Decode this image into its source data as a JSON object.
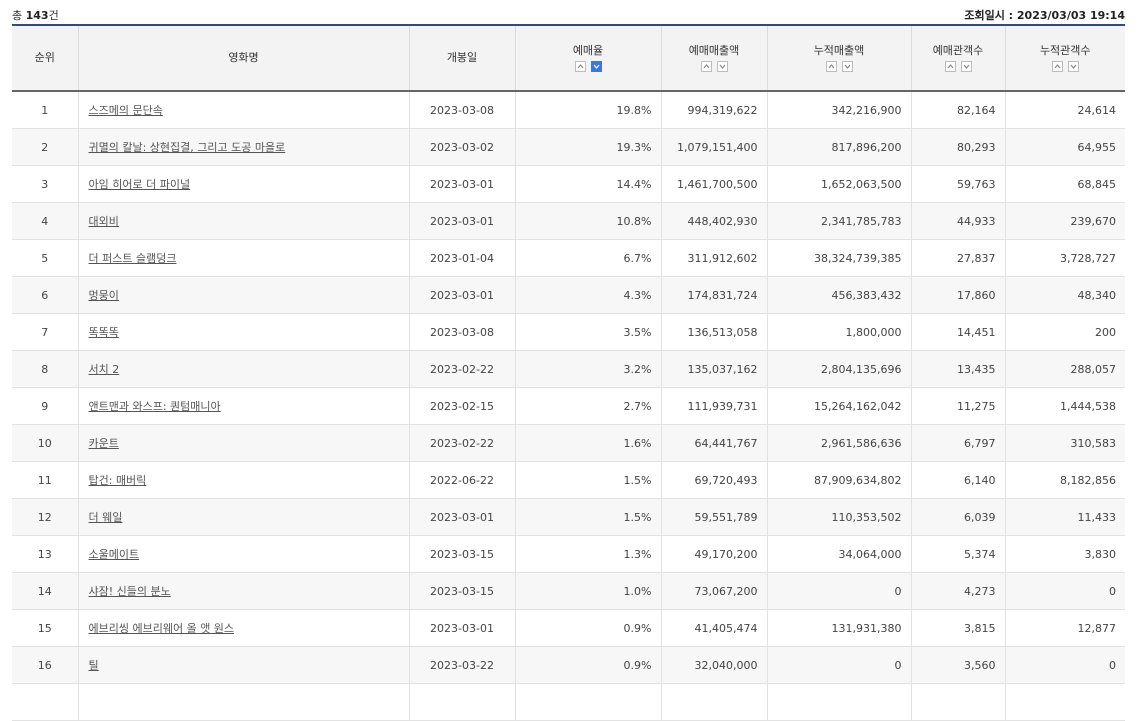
{
  "header": {
    "total_prefix": "총",
    "total_count": "143",
    "total_suffix": "건",
    "timestamp": "조회일시 : 2023/03/03 19:14"
  },
  "columns": [
    {
      "key": "rank",
      "label": "순위",
      "sortable": false
    },
    {
      "key": "title",
      "label": "영화명",
      "sortable": false
    },
    {
      "key": "release",
      "label": "개봉일",
      "sortable": false
    },
    {
      "key": "rate",
      "label": "예매율",
      "sortable": true,
      "active": "down"
    },
    {
      "key": "sales",
      "label": "예매매출액",
      "sortable": true
    },
    {
      "key": "cum_sales",
      "label": "누적매출액",
      "sortable": true
    },
    {
      "key": "audience",
      "label": "예매관객수",
      "sortable": true
    },
    {
      "key": "cum_audience",
      "label": "누적관객수",
      "sortable": true
    }
  ],
  "rows": [
    {
      "rank": "1",
      "title": "스즈메의 문단속",
      "release": "2023-03-08",
      "rate": "19.8%",
      "sales": "994,319,622",
      "cum_sales": "342,216,900",
      "audience": "82,164",
      "cum_audience": "24,614"
    },
    {
      "rank": "2",
      "title": "귀멸의 칼날: 상현집결, 그리고 도공 마을로",
      "release": "2023-03-02",
      "rate": "19.3%",
      "sales": "1,079,151,400",
      "cum_sales": "817,896,200",
      "audience": "80,293",
      "cum_audience": "64,955"
    },
    {
      "rank": "3",
      "title": "아임 히어로 더 파이널",
      "release": "2023-03-01",
      "rate": "14.4%",
      "sales": "1,461,700,500",
      "cum_sales": "1,652,063,500",
      "audience": "59,763",
      "cum_audience": "68,845"
    },
    {
      "rank": "4",
      "title": "대외비",
      "release": "2023-03-01",
      "rate": "10.8%",
      "sales": "448,402,930",
      "cum_sales": "2,341,785,783",
      "audience": "44,933",
      "cum_audience": "239,670"
    },
    {
      "rank": "5",
      "title": "더 퍼스트 슬램덩크",
      "release": "2023-01-04",
      "rate": "6.7%",
      "sales": "311,912,602",
      "cum_sales": "38,324,739,385",
      "audience": "27,837",
      "cum_audience": "3,728,727"
    },
    {
      "rank": "6",
      "title": "멍뭉이",
      "release": "2023-03-01",
      "rate": "4.3%",
      "sales": "174,831,724",
      "cum_sales": "456,383,432",
      "audience": "17,860",
      "cum_audience": "48,340"
    },
    {
      "rank": "7",
      "title": "똑똑똑",
      "release": "2023-03-08",
      "rate": "3.5%",
      "sales": "136,513,058",
      "cum_sales": "1,800,000",
      "audience": "14,451",
      "cum_audience": "200"
    },
    {
      "rank": "8",
      "title": "서치 2",
      "release": "2023-02-22",
      "rate": "3.2%",
      "sales": "135,037,162",
      "cum_sales": "2,804,135,696",
      "audience": "13,435",
      "cum_audience": "288,057"
    },
    {
      "rank": "9",
      "title": "앤트맨과 와스프: 퀀텀매니아",
      "release": "2023-02-15",
      "rate": "2.7%",
      "sales": "111,939,731",
      "cum_sales": "15,264,162,042",
      "audience": "11,275",
      "cum_audience": "1,444,538"
    },
    {
      "rank": "10",
      "title": "카운트",
      "release": "2023-02-22",
      "rate": "1.6%",
      "sales": "64,441,767",
      "cum_sales": "2,961,586,636",
      "audience": "6,797",
      "cum_audience": "310,583"
    },
    {
      "rank": "11",
      "title": "탑건: 매버릭",
      "release": "2022-06-22",
      "rate": "1.5%",
      "sales": "69,720,493",
      "cum_sales": "87,909,634,802",
      "audience": "6,140",
      "cum_audience": "8,182,856"
    },
    {
      "rank": "12",
      "title": "더 웨일",
      "release": "2023-03-01",
      "rate": "1.5%",
      "sales": "59,551,789",
      "cum_sales": "110,353,502",
      "audience": "6,039",
      "cum_audience": "11,433"
    },
    {
      "rank": "13",
      "title": "소울메이트",
      "release": "2023-03-15",
      "rate": "1.3%",
      "sales": "49,170,200",
      "cum_sales": "34,064,000",
      "audience": "5,374",
      "cum_audience": "3,830"
    },
    {
      "rank": "14",
      "title": "샤잠! 신들의 분노",
      "release": "2023-03-15",
      "rate": "1.0%",
      "sales": "73,067,200",
      "cum_sales": "0",
      "audience": "4,273",
      "cum_audience": "0"
    },
    {
      "rank": "15",
      "title": "에브리씽 에브리웨어 올 앳 원스",
      "release": "2023-03-01",
      "rate": "0.9%",
      "sales": "41,405,474",
      "cum_sales": "131,931,380",
      "audience": "3,815",
      "cum_audience": "12,877"
    },
    {
      "rank": "16",
      "title": "틸",
      "release": "2023-03-22",
      "rate": "0.9%",
      "sales": "32,040,000",
      "cum_sales": "0",
      "audience": "3,560",
      "cum_audience": "0"
    },
    {
      "rank": "",
      "title": "",
      "release": "",
      "rate": "",
      "sales": "",
      "cum_sales": "",
      "audience": "",
      "cum_audience": ""
    }
  ]
}
